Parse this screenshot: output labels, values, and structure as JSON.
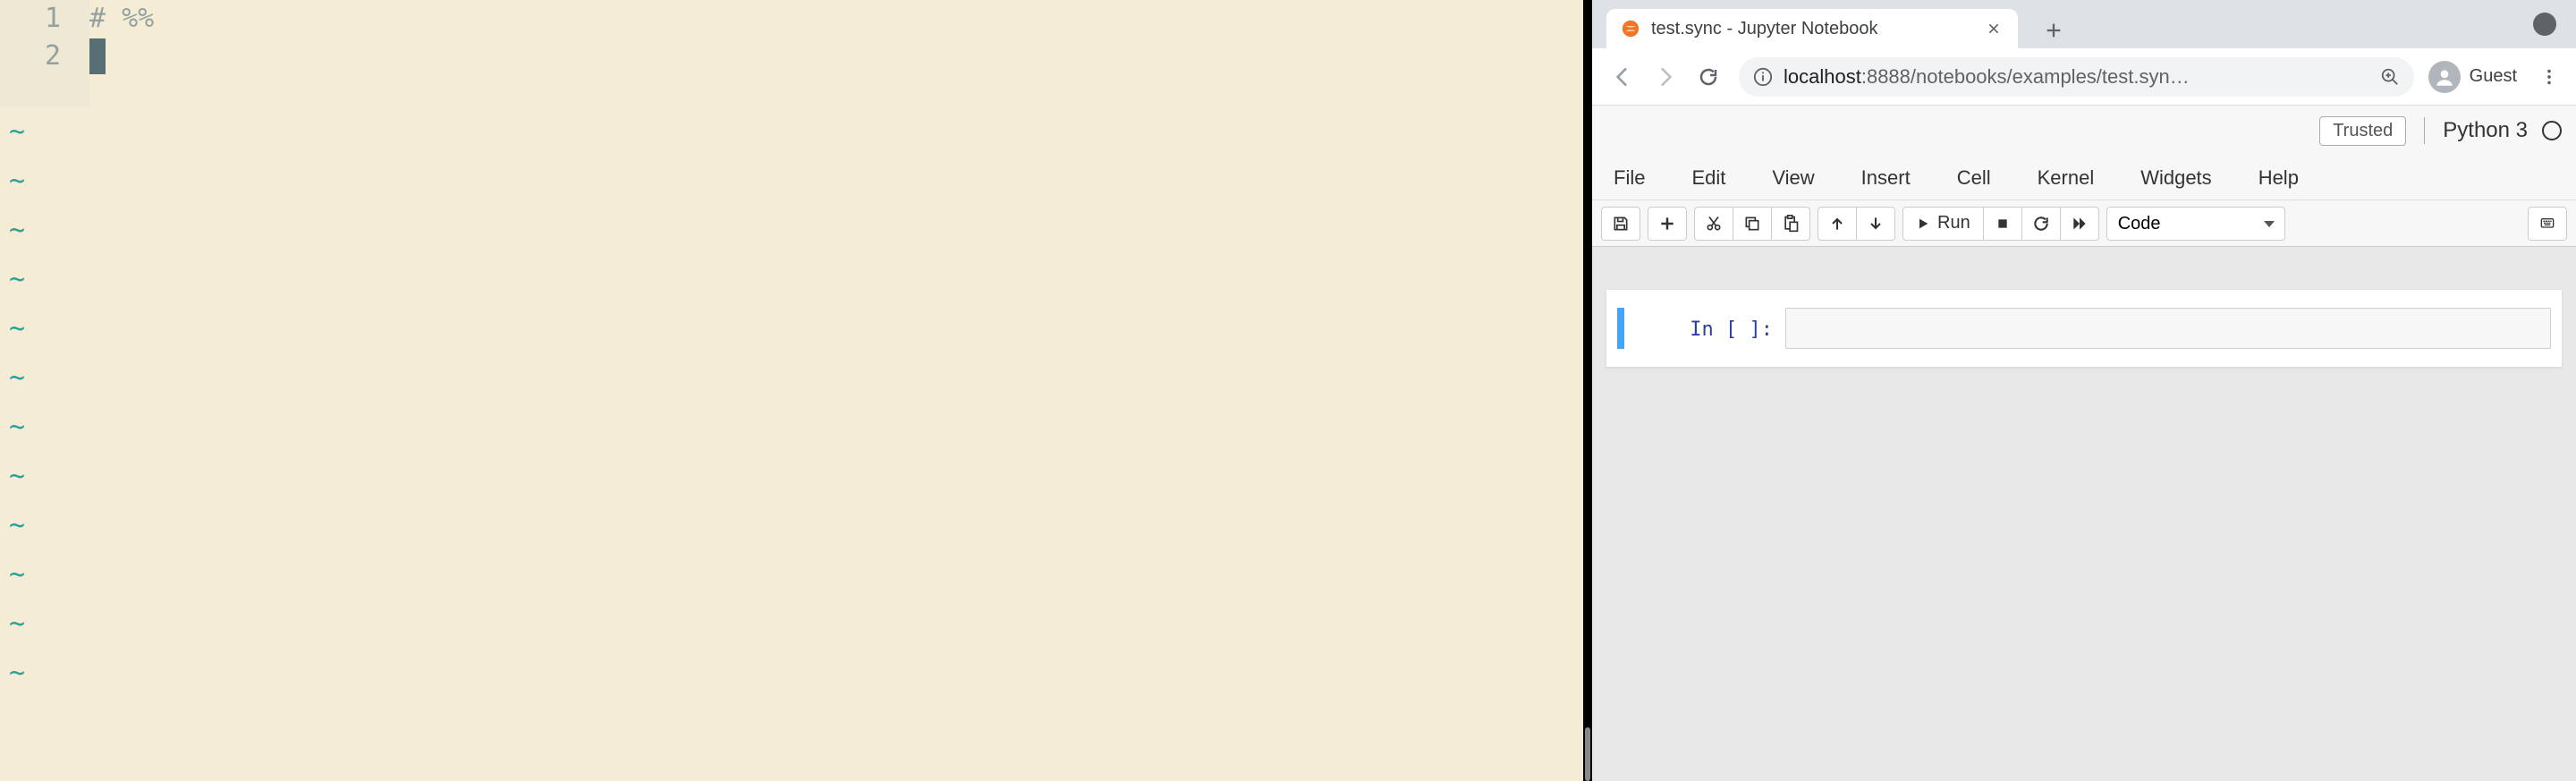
{
  "editor": {
    "lines": [
      {
        "num": "1",
        "content": "# %%"
      },
      {
        "num": "2",
        "content": ""
      }
    ],
    "tilde_char": "~",
    "tilde_count": 12
  },
  "browser": {
    "tab": {
      "title": "test.sync - Jupyter Notebook"
    },
    "url_host": "localhost",
    "url_port_path": ":8888/notebooks/examples/test.syn…",
    "profile_label": "Guest"
  },
  "jupyter": {
    "trusted": "Trusted",
    "kernel": "Python 3",
    "menus": [
      "File",
      "Edit",
      "View",
      "Insert",
      "Cell",
      "Kernel",
      "Widgets",
      "Help"
    ],
    "run_label": "Run",
    "celltype": "Code",
    "cell_prompt": "In [ ]:"
  }
}
